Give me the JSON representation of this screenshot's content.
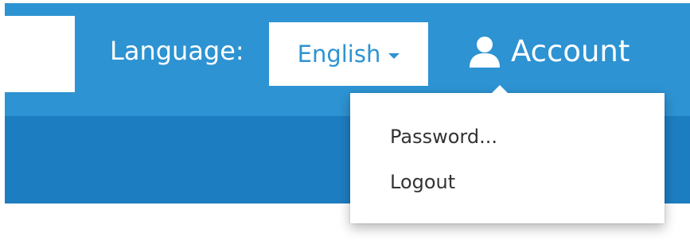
{
  "header": {
    "language_label": "Language:",
    "language_selected": "English",
    "account_label": "Account"
  },
  "account_menu": {
    "items": [
      {
        "label": "Password..."
      },
      {
        "label": "Logout"
      }
    ]
  },
  "icons": {
    "language_caret": "caret-down-icon",
    "account": "user-icon"
  },
  "colors": {
    "header_bg": "#2d93d2",
    "subheader_bg": "#1d7dc1",
    "accent_text": "#2d93d2",
    "menu_text": "#333333"
  }
}
